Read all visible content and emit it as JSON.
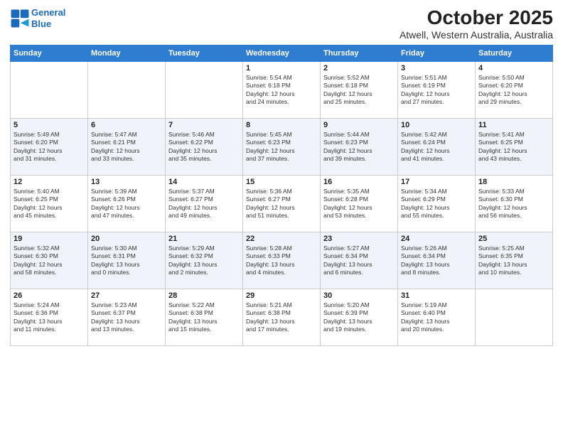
{
  "logo": {
    "line1": "General",
    "line2": "Blue"
  },
  "title": "October 2025",
  "subtitle": "Atwell, Western Australia, Australia",
  "weekdays": [
    "Sunday",
    "Monday",
    "Tuesday",
    "Wednesday",
    "Thursday",
    "Friday",
    "Saturday"
  ],
  "weeks": [
    [
      {
        "day": "",
        "info": ""
      },
      {
        "day": "",
        "info": ""
      },
      {
        "day": "",
        "info": ""
      },
      {
        "day": "1",
        "info": "Sunrise: 5:54 AM\nSunset: 6:18 PM\nDaylight: 12 hours\nand 24 minutes."
      },
      {
        "day": "2",
        "info": "Sunrise: 5:52 AM\nSunset: 6:18 PM\nDaylight: 12 hours\nand 25 minutes."
      },
      {
        "day": "3",
        "info": "Sunrise: 5:51 AM\nSunset: 6:19 PM\nDaylight: 12 hours\nand 27 minutes."
      },
      {
        "day": "4",
        "info": "Sunrise: 5:50 AM\nSunset: 6:20 PM\nDaylight: 12 hours\nand 29 minutes."
      }
    ],
    [
      {
        "day": "5",
        "info": "Sunrise: 5:49 AM\nSunset: 6:20 PM\nDaylight: 12 hours\nand 31 minutes."
      },
      {
        "day": "6",
        "info": "Sunrise: 5:47 AM\nSunset: 6:21 PM\nDaylight: 12 hours\nand 33 minutes."
      },
      {
        "day": "7",
        "info": "Sunrise: 5:46 AM\nSunset: 6:22 PM\nDaylight: 12 hours\nand 35 minutes."
      },
      {
        "day": "8",
        "info": "Sunrise: 5:45 AM\nSunset: 6:23 PM\nDaylight: 12 hours\nand 37 minutes."
      },
      {
        "day": "9",
        "info": "Sunrise: 5:44 AM\nSunset: 6:23 PM\nDaylight: 12 hours\nand 39 minutes."
      },
      {
        "day": "10",
        "info": "Sunrise: 5:42 AM\nSunset: 6:24 PM\nDaylight: 12 hours\nand 41 minutes."
      },
      {
        "day": "11",
        "info": "Sunrise: 5:41 AM\nSunset: 6:25 PM\nDaylight: 12 hours\nand 43 minutes."
      }
    ],
    [
      {
        "day": "12",
        "info": "Sunrise: 5:40 AM\nSunset: 6:25 PM\nDaylight: 12 hours\nand 45 minutes."
      },
      {
        "day": "13",
        "info": "Sunrise: 5:39 AM\nSunset: 6:26 PM\nDaylight: 12 hours\nand 47 minutes."
      },
      {
        "day": "14",
        "info": "Sunrise: 5:37 AM\nSunset: 6:27 PM\nDaylight: 12 hours\nand 49 minutes."
      },
      {
        "day": "15",
        "info": "Sunrise: 5:36 AM\nSunset: 6:27 PM\nDaylight: 12 hours\nand 51 minutes."
      },
      {
        "day": "16",
        "info": "Sunrise: 5:35 AM\nSunset: 6:28 PM\nDaylight: 12 hours\nand 53 minutes."
      },
      {
        "day": "17",
        "info": "Sunrise: 5:34 AM\nSunset: 6:29 PM\nDaylight: 12 hours\nand 55 minutes."
      },
      {
        "day": "18",
        "info": "Sunrise: 5:33 AM\nSunset: 6:30 PM\nDaylight: 12 hours\nand 56 minutes."
      }
    ],
    [
      {
        "day": "19",
        "info": "Sunrise: 5:32 AM\nSunset: 6:30 PM\nDaylight: 12 hours\nand 58 minutes."
      },
      {
        "day": "20",
        "info": "Sunrise: 5:30 AM\nSunset: 6:31 PM\nDaylight: 13 hours\nand 0 minutes."
      },
      {
        "day": "21",
        "info": "Sunrise: 5:29 AM\nSunset: 6:32 PM\nDaylight: 13 hours\nand 2 minutes."
      },
      {
        "day": "22",
        "info": "Sunrise: 5:28 AM\nSunset: 6:33 PM\nDaylight: 13 hours\nand 4 minutes."
      },
      {
        "day": "23",
        "info": "Sunrise: 5:27 AM\nSunset: 6:34 PM\nDaylight: 13 hours\nand 6 minutes."
      },
      {
        "day": "24",
        "info": "Sunrise: 5:26 AM\nSunset: 6:34 PM\nDaylight: 13 hours\nand 8 minutes."
      },
      {
        "day": "25",
        "info": "Sunrise: 5:25 AM\nSunset: 6:35 PM\nDaylight: 13 hours\nand 10 minutes."
      }
    ],
    [
      {
        "day": "26",
        "info": "Sunrise: 5:24 AM\nSunset: 6:36 PM\nDaylight: 13 hours\nand 11 minutes."
      },
      {
        "day": "27",
        "info": "Sunrise: 5:23 AM\nSunset: 6:37 PM\nDaylight: 13 hours\nand 13 minutes."
      },
      {
        "day": "28",
        "info": "Sunrise: 5:22 AM\nSunset: 6:38 PM\nDaylight: 13 hours\nand 15 minutes."
      },
      {
        "day": "29",
        "info": "Sunrise: 5:21 AM\nSunset: 6:38 PM\nDaylight: 13 hours\nand 17 minutes."
      },
      {
        "day": "30",
        "info": "Sunrise: 5:20 AM\nSunset: 6:39 PM\nDaylight: 13 hours\nand 19 minutes."
      },
      {
        "day": "31",
        "info": "Sunrise: 5:19 AM\nSunset: 6:40 PM\nDaylight: 13 hours\nand 20 minutes."
      },
      {
        "day": "",
        "info": ""
      }
    ]
  ]
}
